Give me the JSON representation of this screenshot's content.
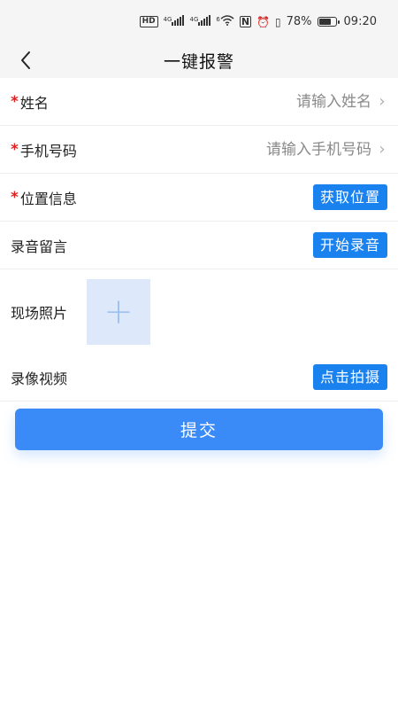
{
  "status_bar": {
    "hd": "HD",
    "net1": "4G",
    "net2": "4G",
    "wifi": "6",
    "battery": "78%",
    "battery_level": 0.78,
    "time": "09:20"
  },
  "nav": {
    "title": "一键报警"
  },
  "form": {
    "required_mark": "*",
    "name": {
      "label": "姓名",
      "placeholder": "请输入姓名",
      "value": ""
    },
    "phone": {
      "label": "手机号码",
      "placeholder": "请输入手机号码",
      "value": ""
    },
    "location": {
      "label": "位置信息",
      "button": "获取位置"
    },
    "voice": {
      "label": "录音留言",
      "button": "开始录音"
    },
    "photo": {
      "label": "现场照片",
      "add_symbol": "+"
    },
    "video": {
      "label": "录像视频",
      "button": "点击拍摄"
    },
    "chevron": "›"
  },
  "submit": {
    "label": "提交"
  },
  "colors": {
    "accent": "#1a82ee",
    "submit": "#3a8bf7",
    "required": "#e02020"
  }
}
